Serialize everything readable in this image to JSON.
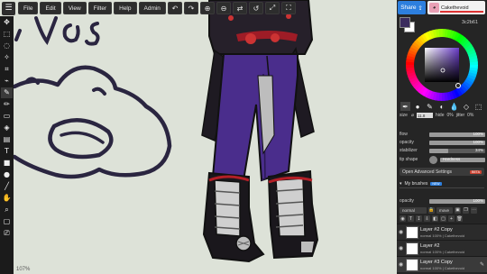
{
  "menu": {
    "logo_icon": "menu-hamburger-icon",
    "items": [
      "File",
      "Edit",
      "View",
      "Filter",
      "Help",
      "Admin"
    ],
    "tool_icons": [
      "zoom-out-icon",
      "undo-icon",
      "redo-icon",
      "zoom-in-icon",
      "zoom-out-icon",
      "swap-icon",
      "rotate-icon",
      "flip-icon",
      "fullscreen-icon"
    ]
  },
  "canvas": {
    "zoom": "107%",
    "background": "#dde2d8"
  },
  "header": {
    "share_label": "Share",
    "username": "Cakethevoid",
    "accent": "#2d7fde"
  },
  "color": {
    "hex": "3c2b61",
    "primary": "#3b2c5e",
    "secondary": "#ffffff"
  },
  "brush": {
    "size_label": "size",
    "size_value": "11.8",
    "hide_label": "hide",
    "hide_value": "0%",
    "jitter_label": "jitter",
    "jitter_value": "0%",
    "flow_label": "flow",
    "flow_value": "100%",
    "opacity_label": "opacity",
    "opacity_value": "100%",
    "stabilizer_label": "stabilizer",
    "stabilizer_value": "34%",
    "tip_label": "tip shape",
    "tip_value": "Hardness",
    "advanced_label": "Open Advanced Settings",
    "advanced_badge": "BETA",
    "my_brushes_label": "My brushes",
    "my_brushes_badge": "NEW",
    "numbers": [
      "1",
      "2",
      "3",
      "4",
      "5"
    ]
  },
  "layers": {
    "opacity_label": "opacity",
    "opacity_value": "100%",
    "blend_mode": "normal",
    "clip_label": "move",
    "items": [
      {
        "name": "Layer #2 Copy",
        "info": "normal 100% | Cakethevoid"
      },
      {
        "name": "Layer #2",
        "info": "normal 100% | Cakethevoid"
      },
      {
        "name": "Layer #3 Copy",
        "info": "normal 100% | Cakethevoid"
      }
    ]
  }
}
